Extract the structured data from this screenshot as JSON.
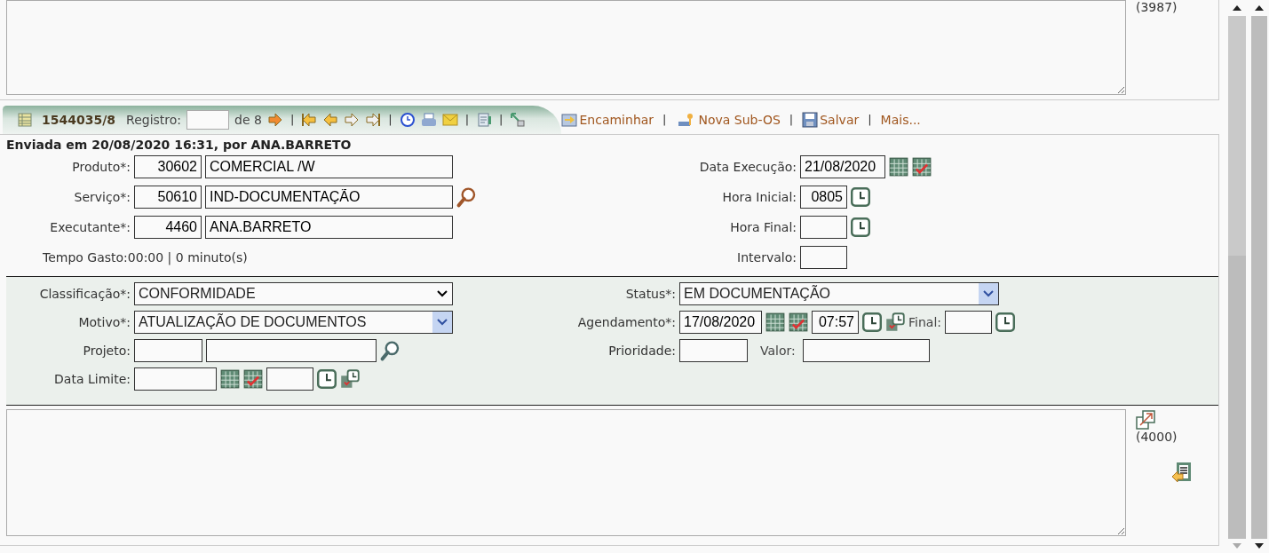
{
  "top_note": {
    "counter": "(3987)"
  },
  "toolbar": {
    "record_id": "1544035/8",
    "record_label": "Registro:",
    "record_total": "de 8",
    "separators": [
      "|",
      "|",
      "|",
      "|"
    ],
    "actions": [
      {
        "kind": "forward",
        "label": "Encaminhar"
      },
      {
        "kind": "sub",
        "label": "Nova Sub-OS",
        "separator": "|"
      },
      {
        "kind": "save",
        "label": "Salvar",
        "separator": "|"
      },
      {
        "kind": "more",
        "label": "Mais...",
        "separator": "|"
      }
    ]
  },
  "sent_info": "Enviada em 20/08/2020 16:31, por ANA.BARRETO",
  "left_fields": [
    {
      "label": "Produto*:",
      "code": "30602",
      "value": "COMERCIAL /W",
      "search": false
    },
    {
      "label": "Serviço*:",
      "code": "50610",
      "value": "IND-DOCUMENTAÇÃO",
      "search": true
    },
    {
      "label": "Executante*:",
      "code": "4460",
      "value": "ANA.BARRETO",
      "search": false
    }
  ],
  "tempo_gasto": "Tempo Gasto:00:00 | 0 minuto(s)",
  "right_fields": [
    {
      "kind": "date",
      "label": "Data Execução:",
      "value": "21/08/2020"
    },
    {
      "kind": "time",
      "label": "Hora Inicial:",
      "value": "0805"
    },
    {
      "kind": "time",
      "label": "Hora Final:"
    },
    {
      "kind": "plain",
      "label": "Intervalo:"
    }
  ],
  "classificacao": {
    "label": "Classificação*:",
    "value": "CONFORMIDADE",
    "kind": "native"
  },
  "motivo": {
    "label": "Motivo*:",
    "value": "ATUALIZAÇÃO DE DOCUMENTOS",
    "kind": "themed"
  },
  "projeto": {
    "label": "Projeto:"
  },
  "data_limite": {
    "label": "Data Limite:"
  },
  "status": {
    "label": "Status*:",
    "value": "EM DOCUMENTAÇÃO",
    "kind": "themed"
  },
  "agendamento": {
    "label": "Agendamento*:",
    "date": "17/08/2020",
    "time": "07:57",
    "final_label": "Final:"
  },
  "prioridade": {
    "label": "Prioridade:",
    "valor_label": "Valor:"
  },
  "notes": {
    "counter": "(4000)"
  }
}
